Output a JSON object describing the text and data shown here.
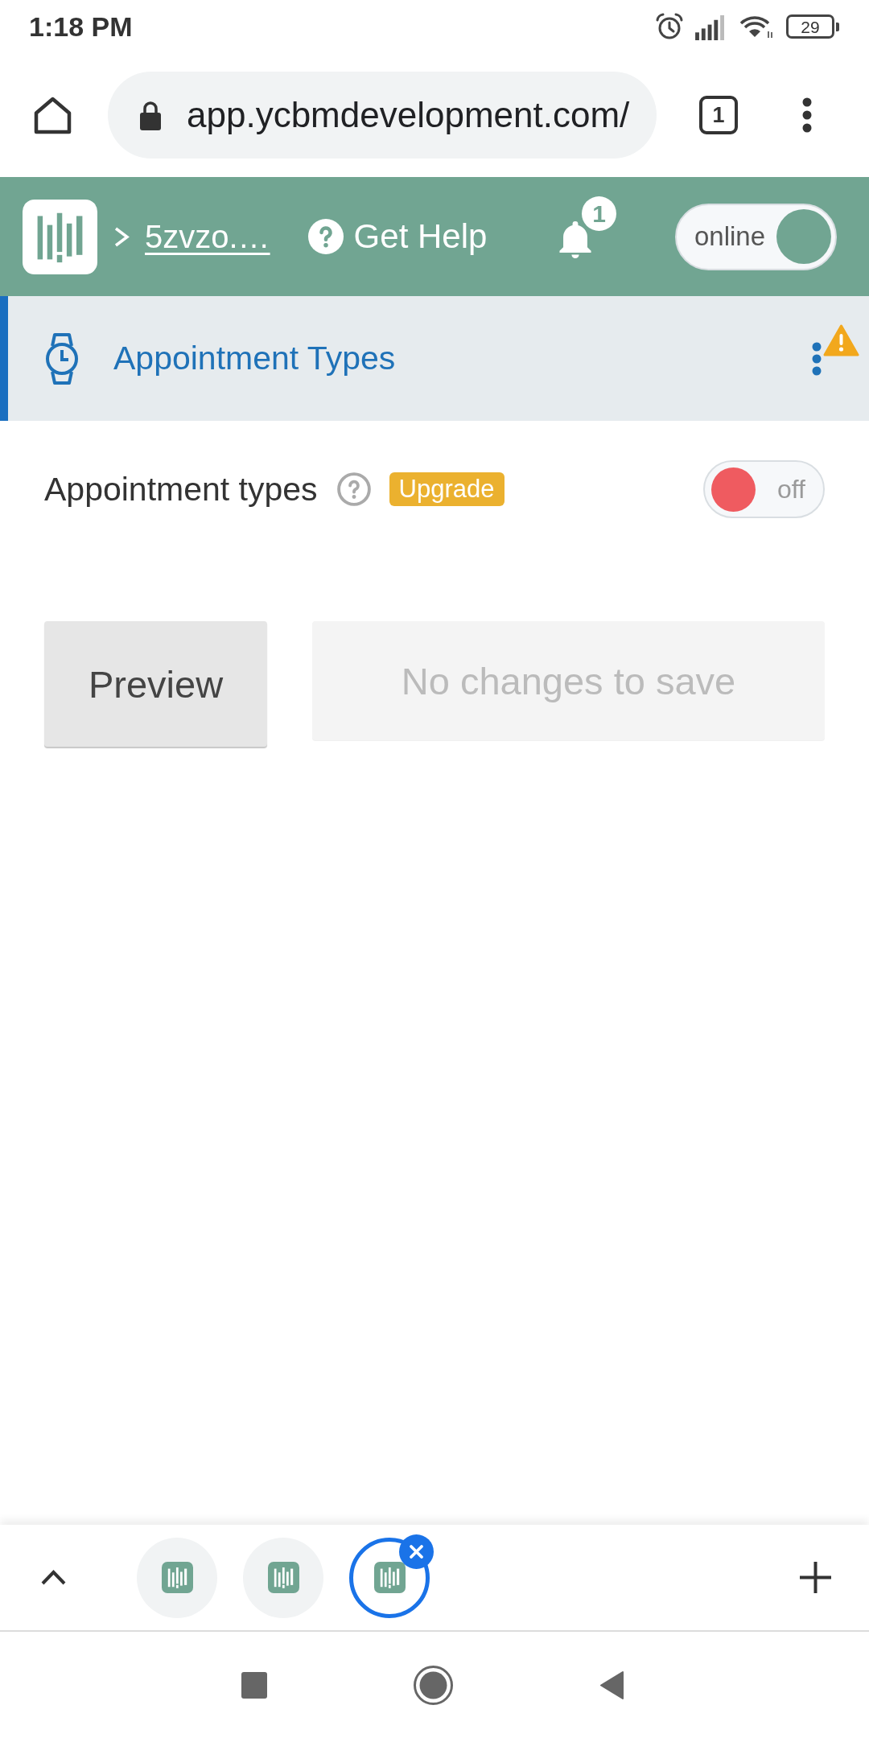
{
  "status_bar": {
    "time": "1:18 PM",
    "battery": "29"
  },
  "browser": {
    "url": "app.ycbmdevelopment.com/",
    "tab_count": "1"
  },
  "app_header": {
    "breadcrumb": "5zvzo.…",
    "help": "Get Help",
    "notifications": "1",
    "status_toggle": {
      "label": "online",
      "on": true
    }
  },
  "section_nav": {
    "title": "Appointment Types",
    "selected": true
  },
  "setting": {
    "label": "Appointment types",
    "badge": "Upgrade",
    "toggle": {
      "label": "off",
      "on": false
    }
  },
  "actions": [
    {
      "label": "Preview",
      "disabled": false
    },
    {
      "label": "No changes to save",
      "disabled": true
    }
  ],
  "tab_switcher": {
    "tabs": [
      {
        "selected": false
      },
      {
        "selected": false
      },
      {
        "selected": true
      }
    ]
  }
}
